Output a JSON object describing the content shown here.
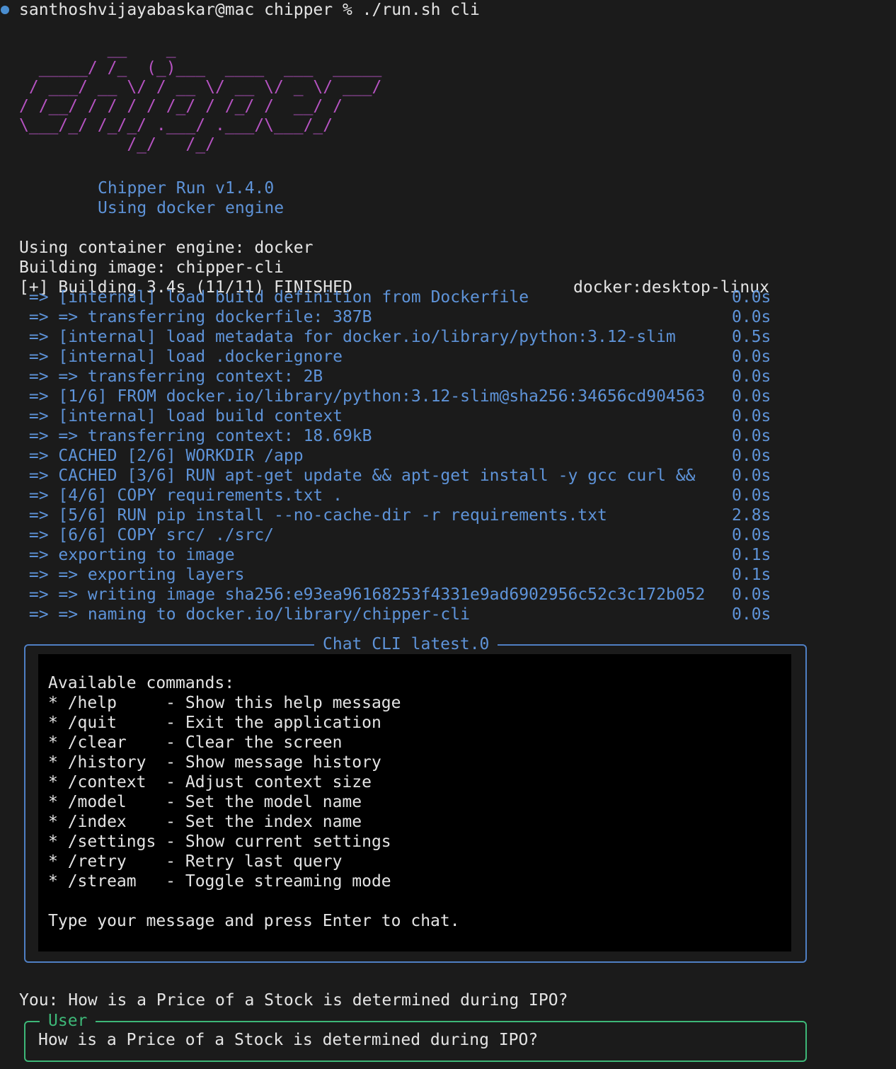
{
  "prompt": {
    "text": "santhoshvijayabaskar@mac chipper % ./run.sh cli"
  },
  "logo": {
    "lines": [
      "         __    _",
      "  _____/ /_  (_)___  ____  ___  _____",
      " / ___/ __ \\/ / __ \\/ __ \\/ _ \\/ ___/",
      "/ /__/ / / / / /_/ / /_/ /  __/ /",
      "\\___/_/ /_/_/ .___/ .___/\\___/_/",
      "           /_/   /_/"
    ]
  },
  "banner": {
    "version": "Chipper Run v1.4.0",
    "engine": "Using docker engine"
  },
  "status": {
    "container": "Using container engine: docker",
    "image": "Building image: chipper-cli"
  },
  "build": {
    "header": "[+] Building 3.4s (11/11) FINISHED",
    "context": "docker:desktop-linux",
    "steps": [
      {
        "text": " => [internal] load build definition from Dockerfile",
        "time": "0.0s"
      },
      {
        "text": " => => transferring dockerfile: 387B",
        "time": "0.0s"
      },
      {
        "text": " => [internal] load metadata for docker.io/library/python:3.12-slim",
        "time": "0.5s"
      },
      {
        "text": " => [internal] load .dockerignore",
        "time": "0.0s"
      },
      {
        "text": " => => transferring context: 2B",
        "time": "0.0s"
      },
      {
        "text": " => [1/6] FROM docker.io/library/python:3.12-slim@sha256:34656cd904563",
        "time": "0.0s"
      },
      {
        "text": " => [internal] load build context",
        "time": "0.0s"
      },
      {
        "text": " => => transferring context: 18.69kB",
        "time": "0.0s"
      },
      {
        "text": " => CACHED [2/6] WORKDIR /app",
        "time": "0.0s"
      },
      {
        "text": " => CACHED [3/6] RUN apt-get update && apt-get install -y gcc curl &&",
        "time": "0.0s"
      },
      {
        "text": " => [4/6] COPY requirements.txt .",
        "time": "0.0s"
      },
      {
        "text": " => [5/6] RUN pip install --no-cache-dir -r requirements.txt",
        "time": "2.8s"
      },
      {
        "text": " => [6/6] COPY src/ ./src/",
        "time": "0.0s"
      },
      {
        "text": " => exporting to image",
        "time": "0.1s"
      },
      {
        "text": " => => exporting layers",
        "time": "0.1s"
      },
      {
        "text": " => => writing image sha256:e93ea96168253f4331e9ad6902956c52c3c172b052",
        "time": "0.0s"
      },
      {
        "text": " => => naming to docker.io/library/chipper-cli",
        "time": "0.0s"
      }
    ]
  },
  "chat": {
    "title": "Chat CLI latest.0",
    "help_heading": "Available commands:",
    "commands": [
      "* /help     - Show this help message",
      "* /quit     - Exit the application",
      "* /clear    - Clear the screen",
      "* /history  - Show message history",
      "* /context  - Adjust context size",
      "* /model    - Set the model name",
      "* /index    - Set the index name",
      "* /settings - Show current settings",
      "* /retry    - Retry last query",
      "* /stream   - Toggle streaming mode"
    ],
    "hint": "Type your message and press Enter to chat."
  },
  "conversation": {
    "you_line": "You: How is a Price of a Stock is determined during IPO?",
    "user_panel_title": "User",
    "user_message": "How is a Price of a Stock is determined during IPO?"
  },
  "colors": {
    "accent_blue": "#5e93d8",
    "logo_purple": "#b653c2",
    "user_green": "#3db878",
    "background": "#1b1b1b"
  }
}
